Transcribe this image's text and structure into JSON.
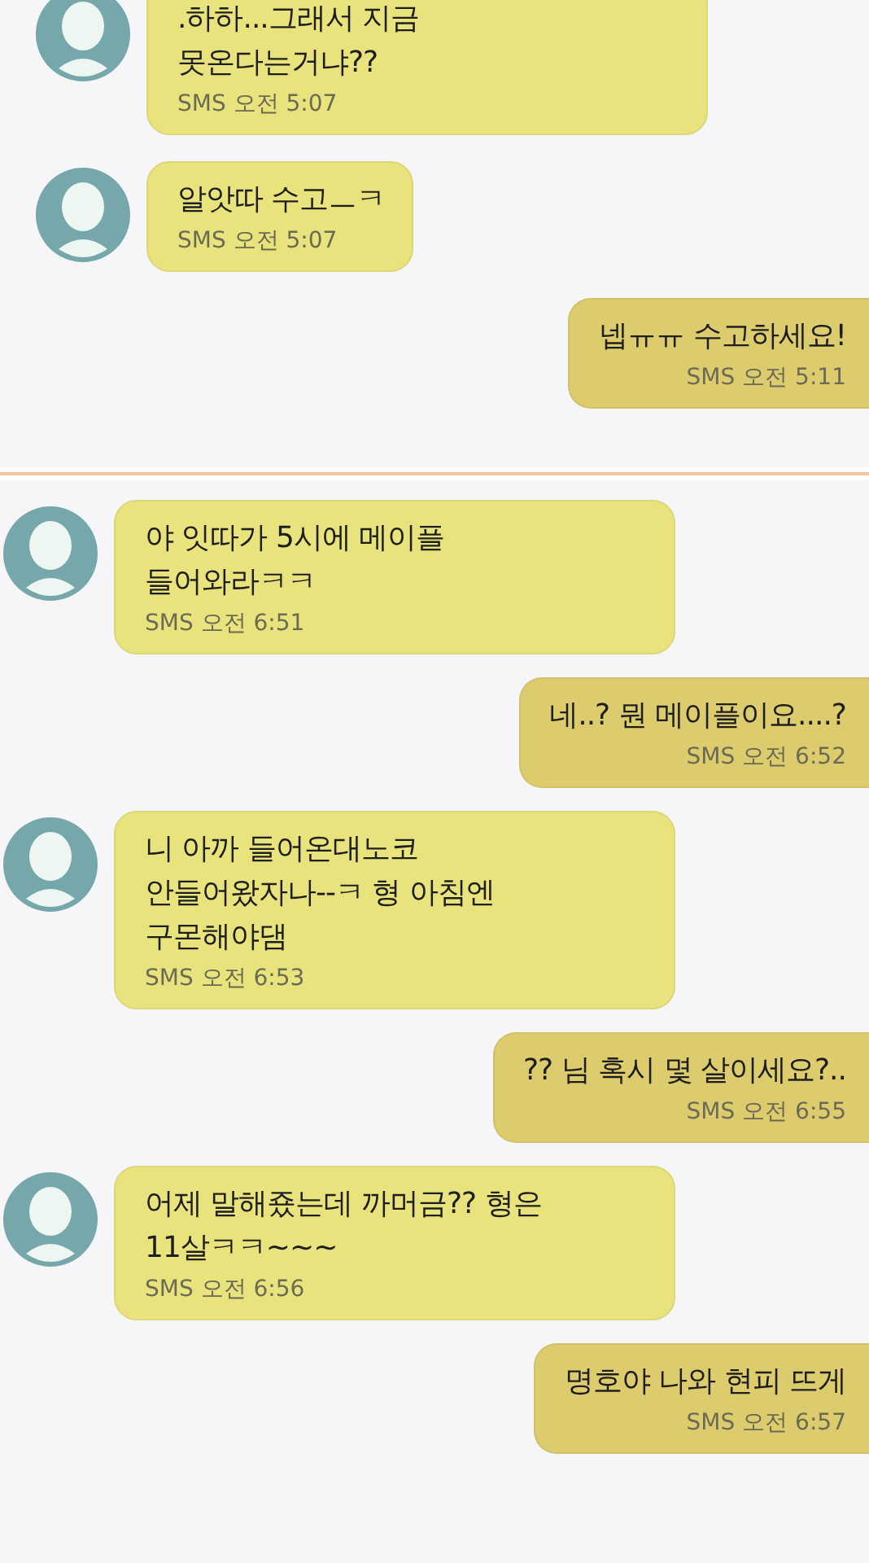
{
  "panels": [
    {
      "messages": [
        {
          "kind": "received",
          "text": ".하하...그래서 지금\n못온다는거냐??",
          "time": "SMS 오전 5:07"
        },
        {
          "kind": "received",
          "text": "알앗따 수고ㅡㅋ",
          "time": "SMS 오전 5:07"
        },
        {
          "kind": "sent",
          "text": "넵ㅠㅠ 수고하세요!",
          "time": "SMS 오전 5:11"
        }
      ]
    },
    {
      "messages": [
        {
          "kind": "received",
          "text": "야 잇따가 5시에 메이플\n들어와라ㅋㅋ",
          "time": "SMS 오전 6:51"
        },
        {
          "kind": "sent",
          "text": "네..? 뭔 메이플이요....?",
          "time": "SMS 오전 6:52"
        },
        {
          "kind": "received",
          "text": "니 아까 들어온대노코\n안들어왔자나--ㅋ 형 아침엔\n구몬해야댐",
          "time": "SMS 오전 6:53"
        },
        {
          "kind": "sent",
          "text": "?? 님 혹시 몇 살이세요?..",
          "time": "SMS 오전 6:55"
        },
        {
          "kind": "received",
          "text": "어제 말해죴는데 까머금??  형은\n11살ㅋㅋ~~~",
          "time": "SMS 오전 6:56"
        },
        {
          "kind": "sent",
          "text": "명호야 나와 현피 뜨게",
          "time": "SMS 오전 6:57"
        }
      ]
    }
  ]
}
